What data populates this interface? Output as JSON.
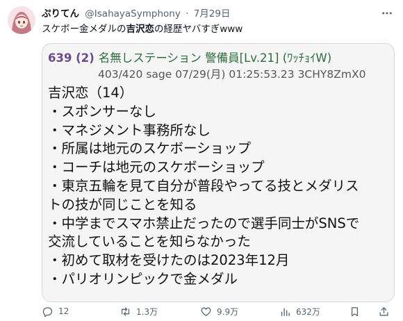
{
  "tweet": {
    "display_name": "ぷりてん",
    "handle": "@IsahayaSymphony",
    "separator": "·",
    "date": "7月29日",
    "text_before": "スケボー金メダルの",
    "text_bold": "吉沢恋",
    "text_after": "の経歴ヤバすぎwww"
  },
  "post": {
    "number": "639 (2)",
    "name": "名無しステーション 警備員[Lv.21] (ﾜｯﾁｮｲW)",
    "meta": "403/420 sage 07/29(月) 01:25:53.23 3CHY8ZmX0",
    "lines": [
      "吉沢恋（14）",
      "・スポンサーなし",
      "・マネジメント事務所なし",
      "・所属は地元のスケボーショップ",
      "・コーチは地元のスケボーショップ",
      "・東京五輪を見て自分が普段やってる技とメダリス",
      "トの技が同じことを知る",
      "・中学までスマホ禁止だったので選手同士がSNSで",
      "交流していることを知らなかった",
      "・初めて取材を受けたのは2023年12月",
      "・パリオリンピックで金メダル"
    ]
  },
  "actions": {
    "replies": "12",
    "retweets": "1.3万",
    "likes": "9.9万",
    "views": "632万"
  },
  "icons": {
    "reply": "reply-icon",
    "retweet": "retweet-icon",
    "like": "heart-icon",
    "views": "views-icon",
    "bookmark": "bookmark-icon",
    "share": "share-icon",
    "more": "more-icon"
  },
  "colors": {
    "text": "#0f1419",
    "secondary": "#536471",
    "border": "#cfd9de",
    "post_number": "#6d4a8e",
    "post_name": "#2e6b3c",
    "post_bg": "#f5f5f5"
  }
}
